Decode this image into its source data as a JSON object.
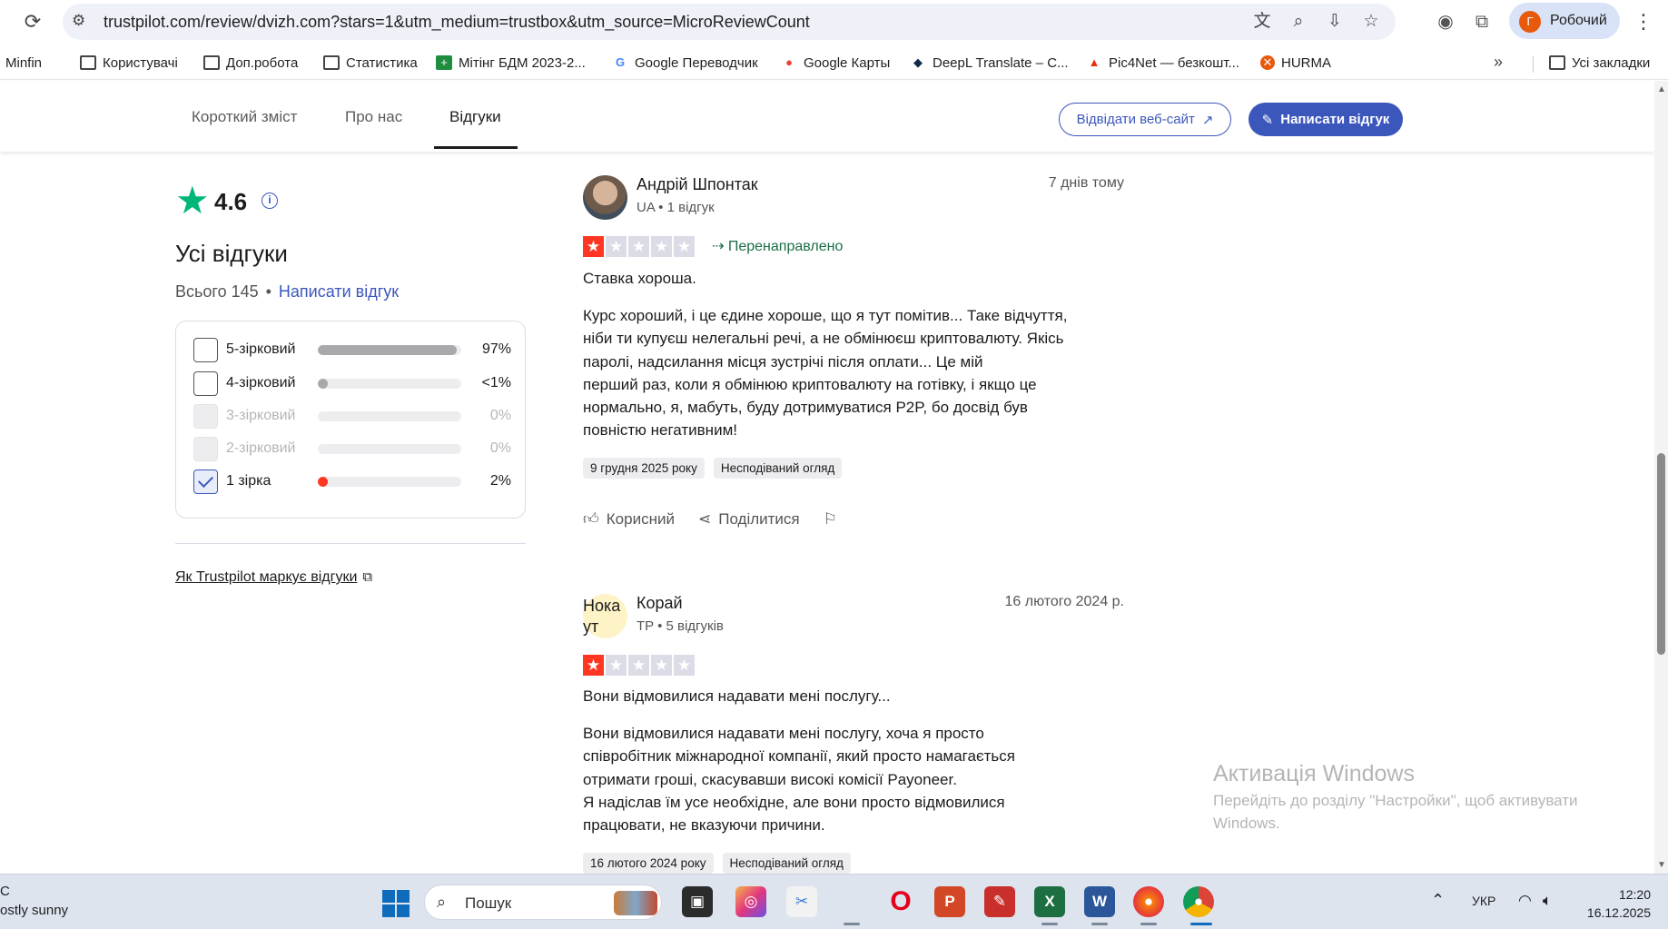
{
  "browser": {
    "url": "trustpilot.com/review/dvizh.com?stars=1&utm_medium=trustbox&utm_source=MicroReviewCount",
    "profile_initial": "Г",
    "profile_name": "Робочий",
    "bookmarks": [
      "Minfin",
      "Користувачі",
      "Доп.робота",
      "Статистика",
      "Мітінг БДМ 2023-2...",
      "Google Переводчик",
      "Google Карты",
      "DeepL Translate – С...",
      "Pic4Net — безкошт...",
      "HURMA"
    ],
    "bookmarks_more": "»",
    "all_bookmarks": "Усі закладки"
  },
  "site_header": {
    "tabs": [
      "Короткий зміст",
      "Про нас",
      "Відгуки"
    ],
    "active_tab": 2,
    "visit_label": "Відвідати веб-сайт",
    "write_label": "Написати відгук"
  },
  "sidebar": {
    "rating": "4.6",
    "heading": "Усі відгуки",
    "total_label": "Всього 145",
    "total_dot": "•",
    "write_link": "Написати відгук",
    "filters": [
      {
        "label": "5-зірковий",
        "percent_label": "97%",
        "fill": 0.97,
        "color": "#a9a9ab",
        "state": "unchecked"
      },
      {
        "label": "4-зірковий",
        "percent_label": "<1%",
        "fill": 0.05,
        "color": "#a9a9ab",
        "state": "unchecked"
      },
      {
        "label": "3-зірковий",
        "percent_label": "0%",
        "fill": 0,
        "color": "#a9a9ab",
        "state": "disabled"
      },
      {
        "label": "2-зірковий",
        "percent_label": "0%",
        "fill": 0,
        "color": "#a9a9ab",
        "state": "disabled"
      },
      {
        "label": "1 зірка",
        "percent_label": "2%",
        "fill": 0.05,
        "color": "#ff3722",
        "state": "checked"
      }
    ],
    "how_link": "Як Trustpilot маркує відгуки"
  },
  "reviews": [
    {
      "name": "Андрій Шпонтак",
      "meta": "UA • 1 відгук",
      "date": "7 днів тому",
      "stars": 1,
      "redirect": "Перенаправлено",
      "title": "Ставка хороша.",
      "body": "Курс хороший, і це єдине хороше, що я тут помітив... Таке відчуття,\nніби ти купуєш нелегальні речі, а не обмінюєш криптовалюту. Якісь\nпаролі, надсилання місця зустрічі після оплати... Це мій\nперший раз, коли я обмінюю криптовалюту на готівку, і якщо це\nнормально, я, мабуть, буду дотримуватися P2P, бо досвід був\nповністю негативним!",
      "tags": [
        "9 грудня 2025 року",
        "Несподіваний огляд"
      ],
      "helpful": "Корисний",
      "share": "Поділитися"
    },
    {
      "name": "Корай",
      "initials": "Нока\nут",
      "meta": "TP • 5 відгуків",
      "date": "16 лютого 2024 р.",
      "stars": 1,
      "title": "Вони відмовилися надавати мені послугу...",
      "body": "Вони відмовилися надавати мені послугу, хоча я просто\nспівробітник міжнародної компанії, який просто намагається\nотримати гроші, скасувавши високі комісії Payoneer.\nЯ надіслав їм усе необхідне, але вони просто відмовилися\nпрацювати, не вказуючи причини.",
      "tags": [
        "16 лютого 2024 року",
        "Несподіваний огляд"
      ]
    }
  ],
  "watermark": {
    "title": "Активація Windows",
    "subtitle": "Перейдіть до розділу \"Настройки\", щоб активувати Windows."
  },
  "taskbar": {
    "weather_line1": "C",
    "weather_line2": "ostly sunny",
    "search_placeholder": "Пошук",
    "lang": "УКР",
    "time": "12:20",
    "date": "16.12.2025"
  }
}
